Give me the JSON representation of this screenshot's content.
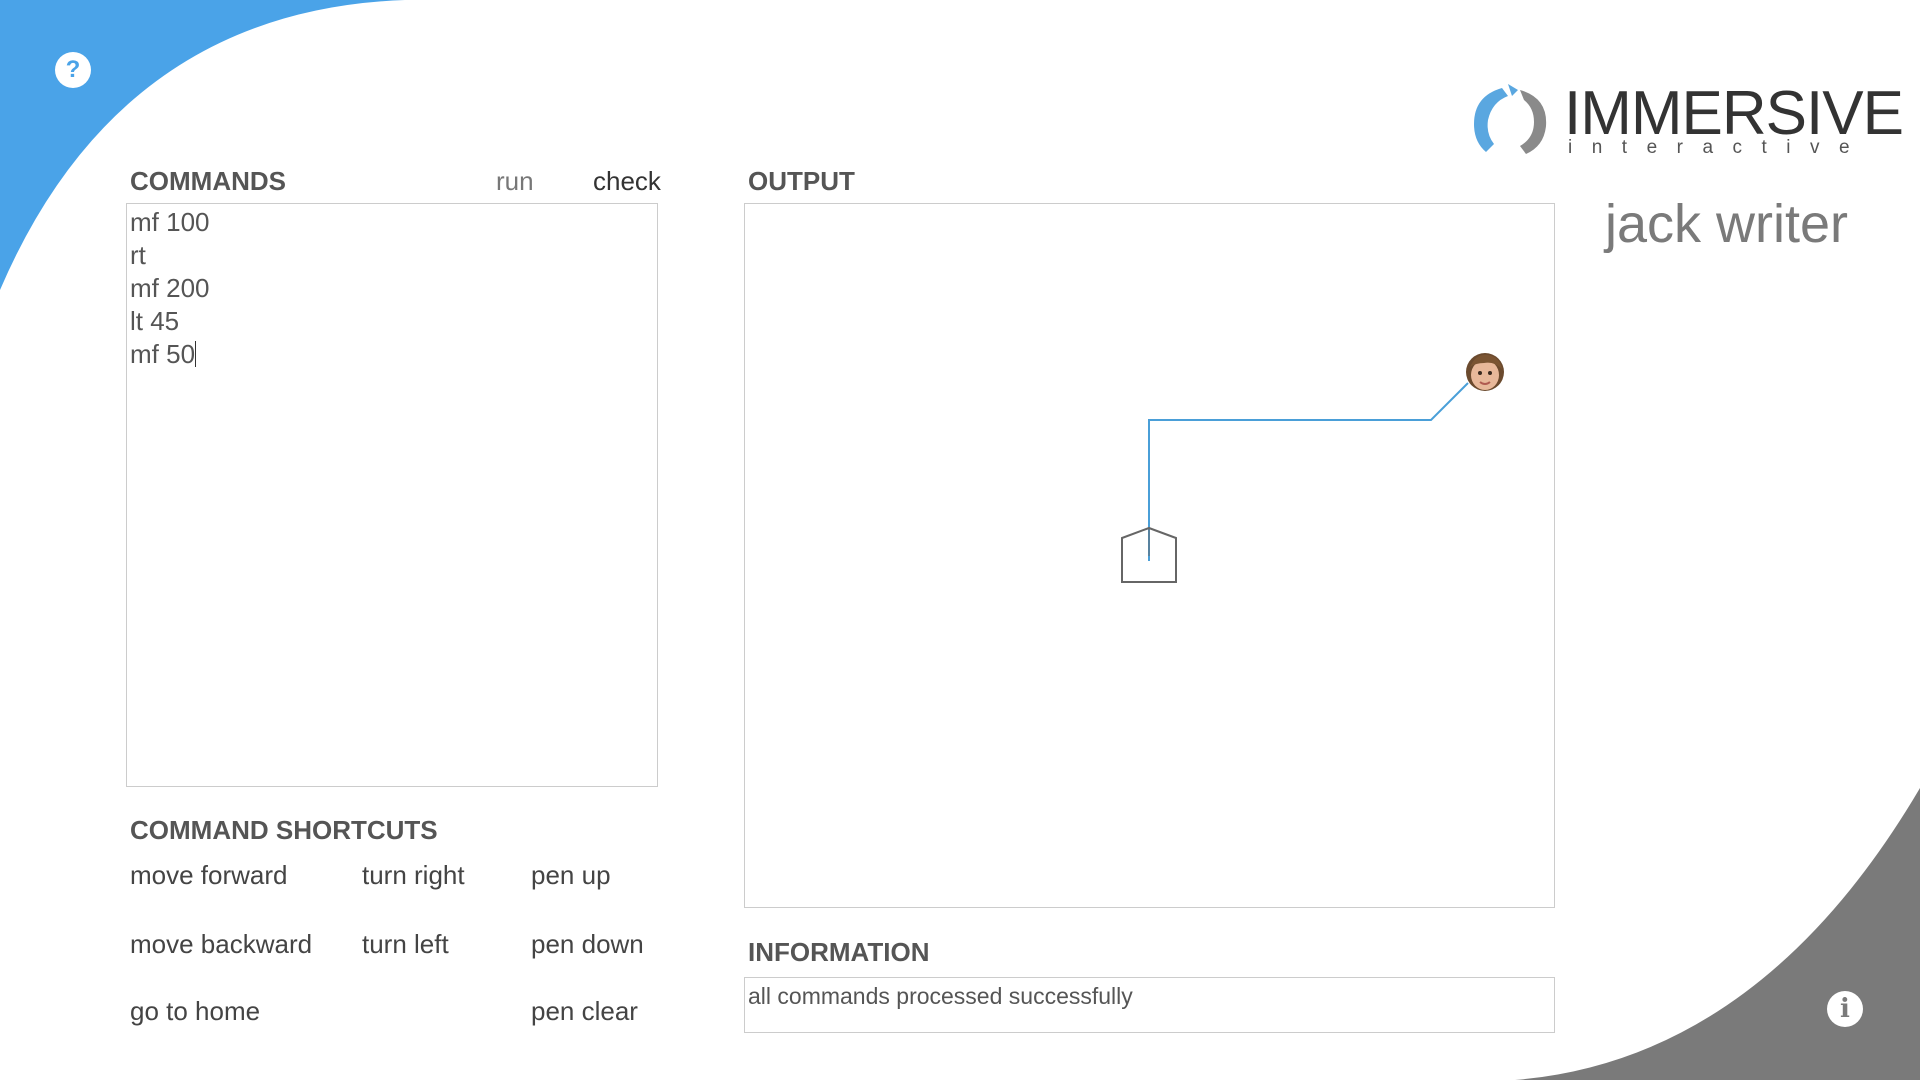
{
  "app": {
    "title": "jack writer"
  },
  "logo": {
    "title": "IMMERSIVE",
    "subtitle": "interactive"
  },
  "colors": {
    "accent_blue": "#4aa3e8",
    "corner_gray": "#7a7a7a",
    "path_blue": "#4a9fd8"
  },
  "icons": {
    "help": "help-icon",
    "info": "info-icon",
    "turtle": "home-arrow-icon",
    "avatar": "face-avatar"
  },
  "help_label": "?",
  "info_label": "i",
  "commands": {
    "title": "COMMANDS",
    "run_label": "run",
    "check_label": "check",
    "lines": [
      "mf 100",
      "rt",
      "mf 200",
      "lt 45",
      "mf 50"
    ]
  },
  "shortcuts": {
    "title": "COMMAND SHORTCUTS",
    "move_forward": "move forward",
    "move_backward": "move backward",
    "go_to_home": "go to home",
    "turn_right": "turn right",
    "turn_left": "turn left",
    "pen_up": "pen up",
    "pen_down": "pen down",
    "pen_clear": "pen clear"
  },
  "output": {
    "title": "OUTPUT"
  },
  "information": {
    "title": "INFORMATION",
    "message": "all commands processed successfully"
  }
}
